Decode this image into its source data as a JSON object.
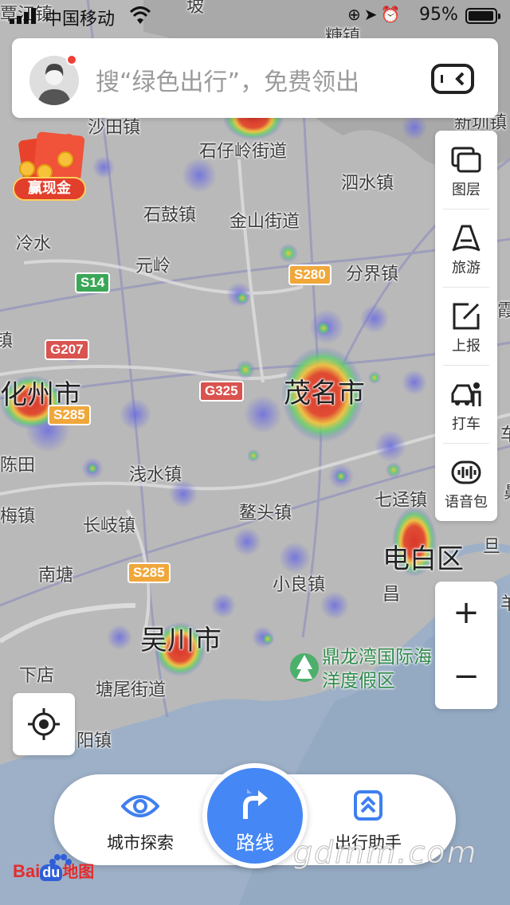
{
  "status_bar": {
    "carrier": "中国移动",
    "battery_pct": "95%",
    "battery_level": 0.95,
    "icons": [
      "lock-rotation-icon",
      "location-arrow-icon",
      "alarm-icon"
    ]
  },
  "search": {
    "placeholder": "搜“绿色出行”，免费领出",
    "avatar_badge": true
  },
  "promo": {
    "label": "赢现金"
  },
  "toolbar": {
    "items": [
      {
        "label": "图层",
        "icon": "layers-icon"
      },
      {
        "label": "旅游",
        "icon": "travel-icon"
      },
      {
        "label": "上报",
        "icon": "report-icon"
      },
      {
        "label": "打车",
        "icon": "taxi-icon"
      },
      {
        "label": "语音包",
        "icon": "voice-pack-icon"
      }
    ]
  },
  "zoom": {
    "in": "+",
    "out": "−"
  },
  "bottom_nav": {
    "explore": "城市探索",
    "route": "路线",
    "assistant": "出行助手"
  },
  "map": {
    "cities": [
      "茂名市",
      "化州市",
      "吴川市",
      "电白区"
    ],
    "places": [
      "沙田镇",
      "石仔岭街道",
      "石鼓镇",
      "金山街道",
      "泗水镇",
      "冷水",
      "元岭",
      "分界镇",
      "浅水镇",
      "鳌头镇",
      "七迳镇",
      "长岐镇",
      "梅镇",
      "陈田",
      "南塘",
      "小良镇",
      "下店",
      "塘尾街道",
      "阳镇",
      "霞",
      "车",
      "旦",
      "镇",
      "鼻",
      "羊",
      "新圳镇",
      "覃江镇",
      "糖镇",
      "昌",
      "坡"
    ],
    "poi": "鼎龙湾国际海洋度假区",
    "roads": [
      "S14",
      "G207",
      "S280",
      "G325",
      "S285",
      "S285",
      "S285"
    ]
  },
  "logo": {
    "bai": "Bai",
    "du": "du",
    "ditu": "地图"
  },
  "watermark": "gdmm.com",
  "colors": {
    "accent": "#4587f5",
    "red": "#e42b2b",
    "heat_hot": "#d9372b"
  }
}
